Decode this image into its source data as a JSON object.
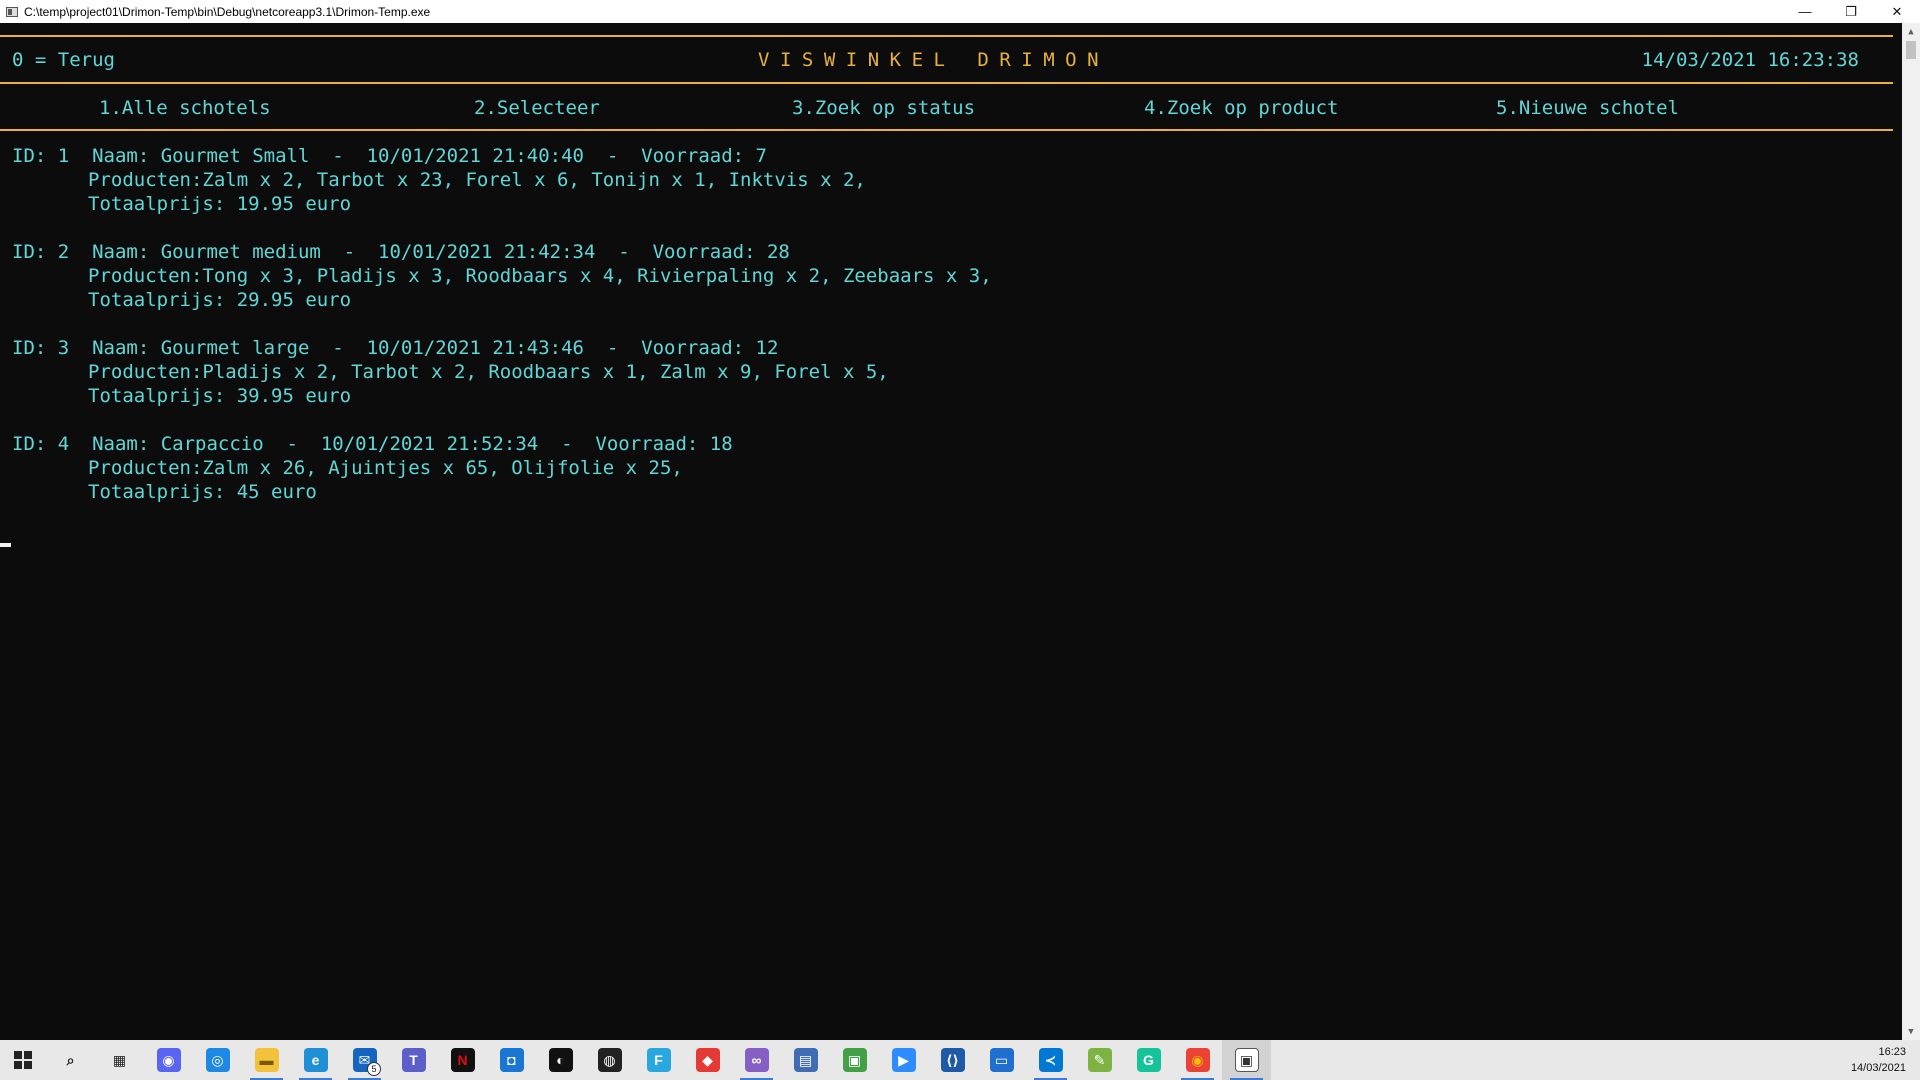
{
  "window": {
    "title": "C:\\temp\\project01\\Drimon-Temp\\bin\\Debug\\netcoreapp3.1\\Drimon-Temp.exe",
    "controls": {
      "minimize": "—",
      "restore": "❐",
      "close": "✕"
    }
  },
  "header": {
    "back": "0 = Terug",
    "title": "VISWINKEL DRIMON",
    "datetime": "14/03/2021 16:23:38"
  },
  "menu": [
    {
      "label": "1.Alle schotels"
    },
    {
      "label": "2.Selecteer"
    },
    {
      "label": "3.Zoek op status"
    },
    {
      "label": "4.Zoek op product"
    },
    {
      "label": "5.Nieuwe schotel"
    }
  ],
  "records": [
    {
      "line1": "ID: 1  Naam: Gourmet Small  -  10/01/2021 21:40:40  -  Voorraad: 7",
      "line2": "Producten:Zalm x 2, Tarbot x 23, Forel x 6, Tonijn x 1, Inktvis x 2,",
      "line3": "Totaalprijs: 19.95 euro"
    },
    {
      "line1": "ID: 2  Naam: Gourmet medium  -  10/01/2021 21:42:34  -  Voorraad: 28",
      "line2": "Producten:Tong x 3, Pladijs x 3, Roodbaars x 4, Rivierpaling x 2, Zeebaars x 3,",
      "line3": "Totaalprijs: 29.95 euro"
    },
    {
      "line1": "ID: 3  Naam: Gourmet large  -  10/01/2021 21:43:46  -  Voorraad: 12",
      "line2": "Producten:Pladijs x 2, Tarbot x 2, Roodbaars x 1, Zalm x 9, Forel x 5,",
      "line3": "Totaalprijs: 39.95 euro"
    },
    {
      "line1": "ID: 4  Naam: Carpaccio  -  10/01/2021 21:52:34  -  Voorraad: 18",
      "line2": "Producten:Zalm x 26, Ajuintjes x 65, Olijfolie x 25,",
      "line3": "Totaalprijs: 45 euro"
    }
  ],
  "taskbar": {
    "icons": [
      {
        "name": "search-icon",
        "glyph": "⌕",
        "color": "#e8e8e8",
        "fg": "#222"
      },
      {
        "name": "task-view-icon",
        "glyph": "▦",
        "color": "#e8e8e8",
        "fg": "#222"
      },
      {
        "name": "discord-icon",
        "glyph": "◉",
        "color": "#5865f2",
        "fg": "#fff"
      },
      {
        "name": "app-circle-icon",
        "glyph": "◎",
        "color": "#1e88e5",
        "fg": "#fff"
      },
      {
        "name": "file-explorer-icon",
        "glyph": "▬",
        "color": "#f3c13a",
        "fg": "#7a5a00"
      },
      {
        "name": "edge-icon",
        "glyph": "e",
        "color": "#1f8fd6",
        "fg": "#fff"
      },
      {
        "name": "mail-icon",
        "glyph": "✉",
        "color": "#1565c0",
        "fg": "#fff"
      },
      {
        "name": "teams-icon",
        "glyph": "T",
        "color": "#5b5fc7",
        "fg": "#fff"
      },
      {
        "name": "netflix-icon",
        "glyph": "N",
        "color": "#111111",
        "fg": "#e50914"
      },
      {
        "name": "app-blue-icon",
        "glyph": "◘",
        "color": "#1976d2",
        "fg": "#fff"
      },
      {
        "name": "github-icon",
        "glyph": "◐",
        "color": "#111111",
        "fg": "#fff"
      },
      {
        "name": "app-dark-icon",
        "glyph": "◍",
        "color": "#222222",
        "fg": "#fff"
      },
      {
        "name": "app-f-icon",
        "glyph": "F",
        "color": "#29a8e0",
        "fg": "#fff"
      },
      {
        "name": "app-red-icon",
        "glyph": "◆",
        "color": "#e53935",
        "fg": "#fff"
      },
      {
        "name": "visual-studio-icon",
        "glyph": "∞",
        "color": "#865fc5",
        "fg": "#fff"
      },
      {
        "name": "app-printer-icon",
        "glyph": "▤",
        "color": "#3f6cb5",
        "fg": "#fff"
      },
      {
        "name": "app-green-icon",
        "glyph": "▣",
        "color": "#43a047",
        "fg": "#fff"
      },
      {
        "name": "zoom-icon",
        "glyph": "▶",
        "color": "#2d8cff",
        "fg": "#fff"
      },
      {
        "name": "app-code-icon",
        "glyph": "⟨⟩",
        "color": "#1e5aa8",
        "fg": "#fff"
      },
      {
        "name": "app-window-icon",
        "glyph": "▭",
        "color": "#1f6fd1",
        "fg": "#fff"
      },
      {
        "name": "vscode-icon",
        "glyph": "≺",
        "color": "#0078d4",
        "fg": "#fff"
      },
      {
        "name": "app-notepad-icon",
        "glyph": "✎",
        "color": "#7cb342",
        "fg": "#fff"
      },
      {
        "name": "grammarly-icon",
        "glyph": "G",
        "color": "#15c39a",
        "fg": "#fff"
      },
      {
        "name": "chrome-icon",
        "glyph": "◉",
        "color": "#ea4335",
        "fg": "#fbbc05"
      },
      {
        "name": "terminal-icon",
        "glyph": "▣",
        "color": "#ffffff",
        "fg": "#333"
      }
    ],
    "mail_badge": "5",
    "clock_time": "16:23",
    "clock_date": "14/03/2021"
  }
}
